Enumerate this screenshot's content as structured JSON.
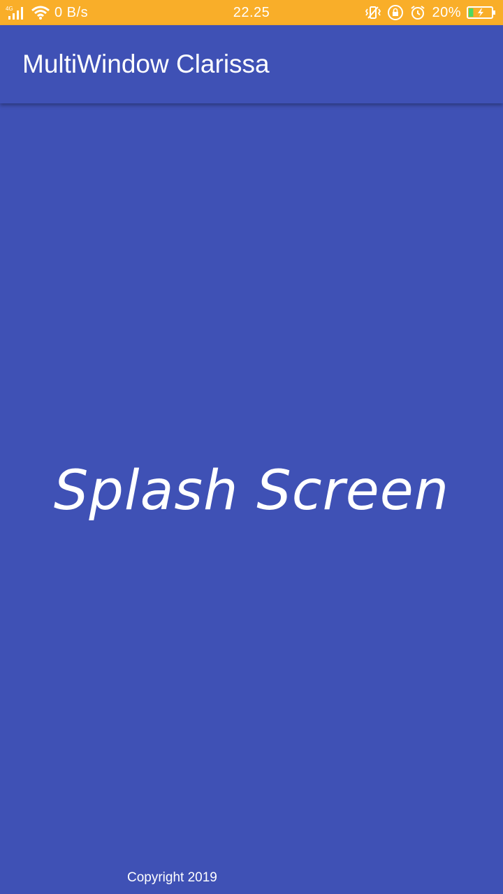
{
  "status_bar": {
    "network_label": "4G",
    "data_rate": "0 B/s",
    "time": "22.25",
    "battery_percent": "20%",
    "battery_level": 0.2,
    "icons": [
      "signal-icon",
      "wifi-icon",
      "vibrate-icon",
      "rotation-lock-icon",
      "alarm-icon",
      "battery-charging-icon"
    ]
  },
  "app_bar": {
    "title": "MultiWindow Clarissa"
  },
  "content": {
    "splash_text": "Splash Screen",
    "copyright": "Copyright 2019"
  },
  "colors": {
    "status_bar": "#F9AE29",
    "primary": "#3F51B5",
    "text": "#FFFFFF",
    "battery_fill": "#4CD964"
  }
}
